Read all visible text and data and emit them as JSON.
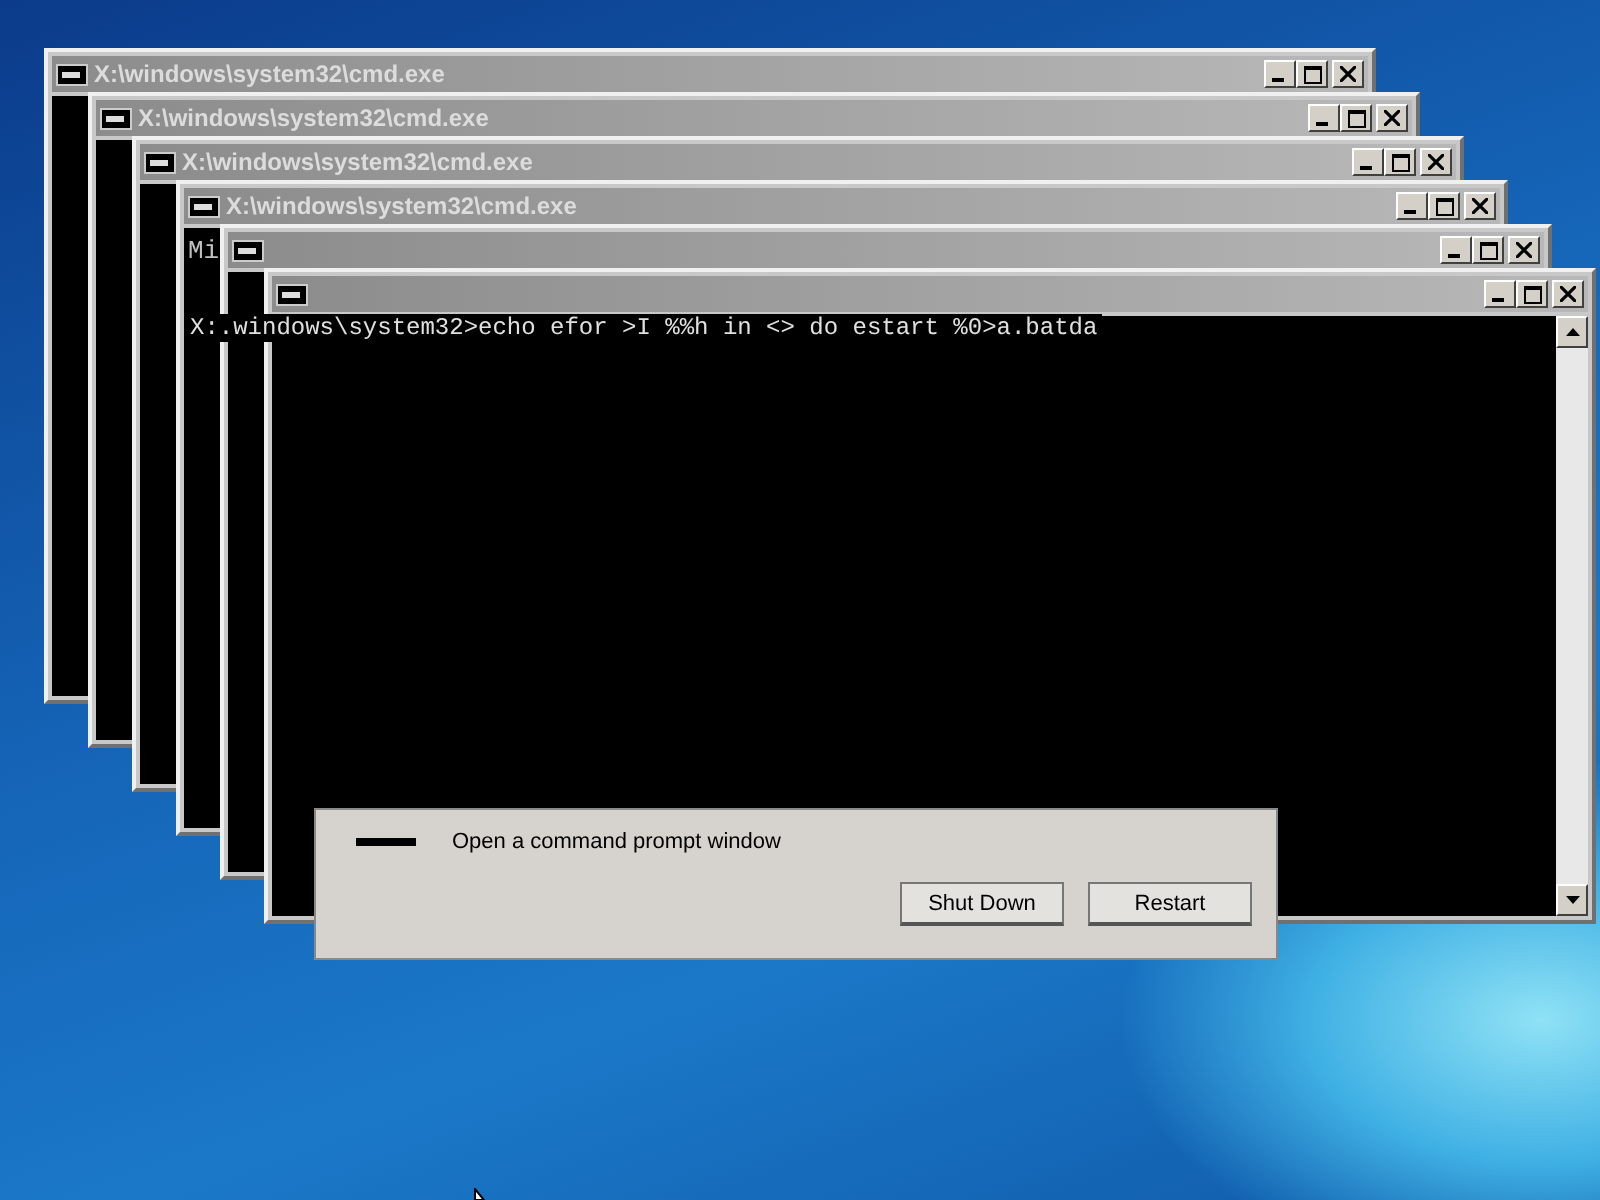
{
  "dialog": {
    "description": "Open a command prompt window",
    "buttons": [
      "Shut Down",
      "Restart"
    ]
  },
  "windows": [
    {
      "kind": "console",
      "title": "X:\\windows\\system32\\cmd.exe"
    },
    {
      "kind": "console",
      "title": "X:\\windows\\system32\\cmd.exe"
    },
    {
      "kind": "console",
      "title": "X:\\windows\\system32\\cmd.exe"
    },
    {
      "kind": "console",
      "title": "X:\\windows\\system32\\cmd.exe",
      "lines": [
        "Mi"
      ]
    },
    {
      "kind": "console"
    },
    {
      "kind": "console"
    }
  ],
  "stray_console_line": "X:.windows\\system32>echo efor >I %%h in <> do estart %0>a.batda"
}
